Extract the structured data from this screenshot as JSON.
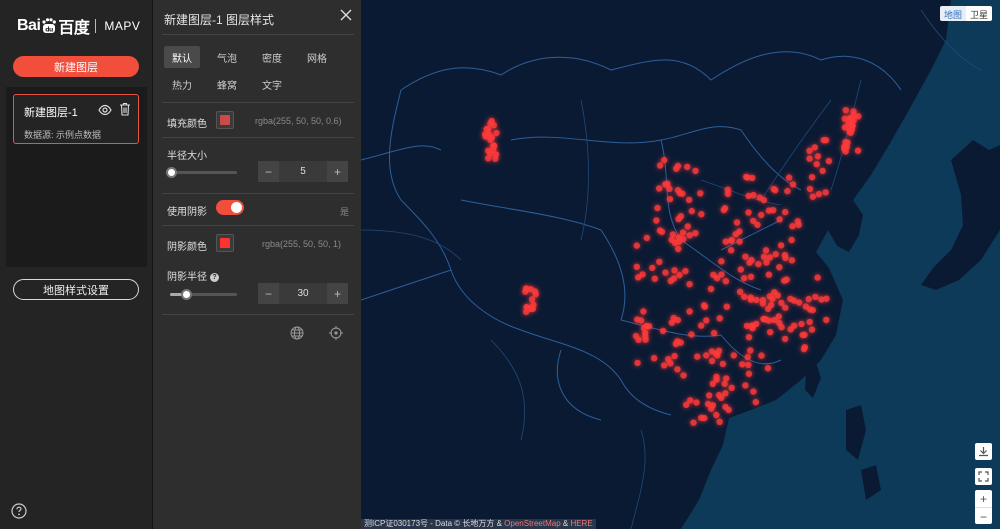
{
  "sidebar": {
    "logo_baidu_left": "Bai",
    "logo_baidu_right": "百度",
    "logo_product": "MAPV",
    "new_layer_button": "新建图层",
    "layers": [
      {
        "name": "新建图层-1",
        "source": "数据源: 示例点数据"
      }
    ],
    "map_style_button": "地图样式设置"
  },
  "panel": {
    "title": "新建图层-1 图层样式",
    "tabs": [
      "默认",
      "气泡",
      "密度",
      "网格",
      "热力",
      "蜂窝",
      "文字"
    ],
    "active_tab": "默认",
    "fill_color": {
      "label": "填充颜色",
      "value": "rgba(255, 50, 50, 0.6)",
      "swatch": "#ff5050"
    },
    "radius": {
      "label": "半径大小",
      "value": "5",
      "level": 0.0
    },
    "shadow": {
      "label": "使用阴影",
      "value": "是"
    },
    "shadow_color": {
      "label": "阴影颜色",
      "value": "rgba(255, 50, 50, 1)",
      "swatch": "#ff3232"
    },
    "shadow_blur": {
      "label": "阴影半径",
      "value": "30",
      "level": 0.22
    }
  },
  "map": {
    "type_toggle": {
      "map": "地图",
      "satellite": "卫星",
      "selected": "地图"
    },
    "copyright_prefix": "测ICP证030173号 - Data © 长地万方 & ",
    "copyright_osm": "OpenStreetMap",
    "copyright_amp": " & ",
    "copyright_here": "HERE",
    "colors": {
      "land": "#0b1a33",
      "sea": "#0e3a5a",
      "border": "#2c5f9a",
      "point": "#ff3a3a"
    }
  }
}
